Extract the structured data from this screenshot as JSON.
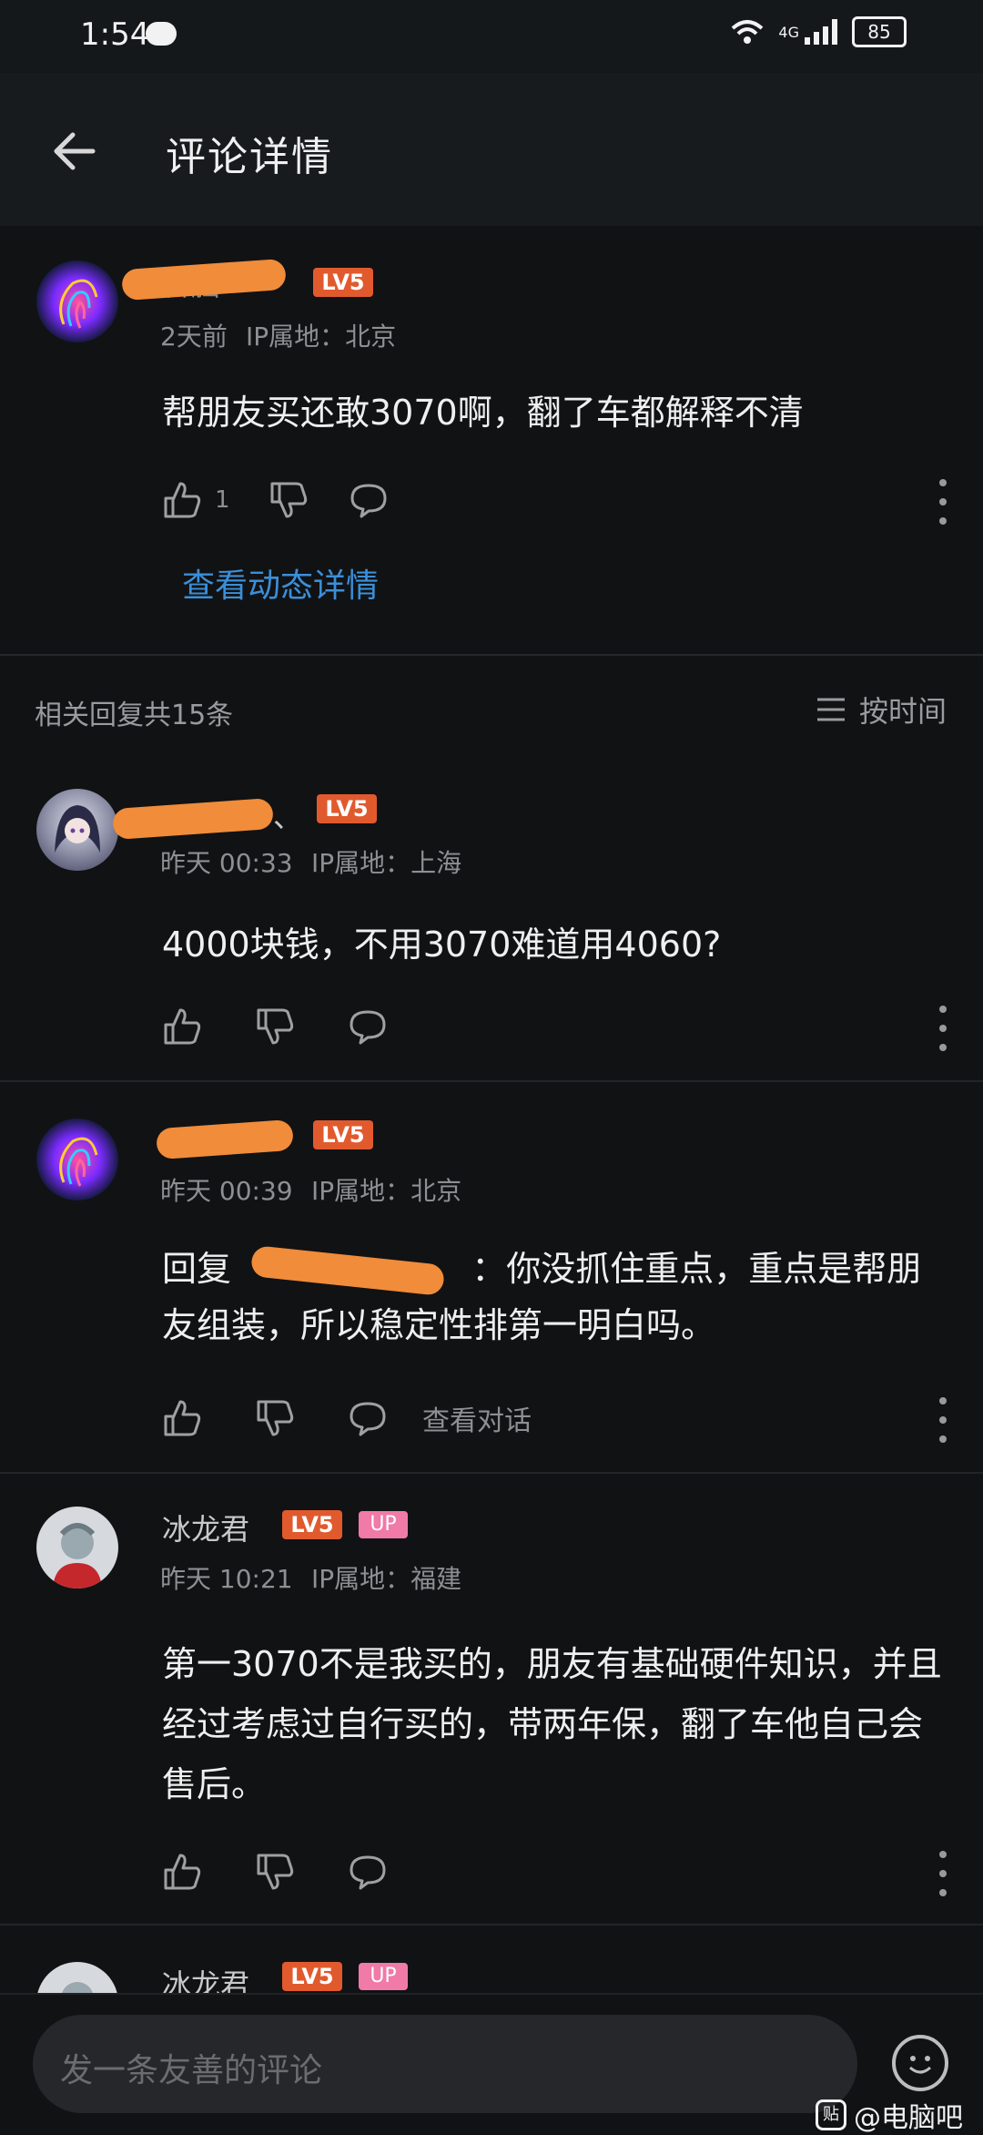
{
  "status_bar": {
    "time": "1:54",
    "network": "4G",
    "battery": "85"
  },
  "header": {
    "title": "评论详情"
  },
  "main_comment": {
    "author_visible": "智脑",
    "level": "LV5",
    "time": "2天前",
    "ip": "IP属地：北京",
    "text": "帮朋友买还敢3070啊，翻了车都解释不清",
    "likes": "1",
    "detail_link": "查看动态详情"
  },
  "replies_section": {
    "label": "相关回复共15条",
    "sort_label": "按时间"
  },
  "replies": [
    {
      "author_visible": "、",
      "level": "LV5",
      "time": "昨天 00:33",
      "ip": "IP属地：上海",
      "text": "4000块钱，不用3070难道用4060?"
    },
    {
      "author_visible": "",
      "level": "LV5",
      "time": "昨天 00:39",
      "ip": "IP属地：北京",
      "reply_prefix": "回复",
      "text": "：你没抓住重点，重点是帮朋友组装，所以稳定性排第一明白吗。",
      "view_conversation": "查看对话"
    },
    {
      "author": "冰龙君",
      "level": "LV5",
      "badge": "UP",
      "time": "昨天 10:21",
      "ip": "IP属地：福建",
      "text": "第一3070不是我买的，朋友有基础硬件知识，并且经过考虑过自行买的，带两年保，翻了车他自己会售后。"
    },
    {
      "author": "冰龙君",
      "level": "LV5",
      "badge": "UP"
    }
  ],
  "input": {
    "placeholder": "发一条友善的评论"
  },
  "watermark": {
    "text": "@电脑吧",
    "logo_text": "贴"
  },
  "colors": {
    "background": "#111214",
    "accent": "#3b8fd9",
    "level_badge": "#e15a2e",
    "redaction": "#f08c3a"
  },
  "icons": [
    "back-arrow-icon",
    "like-icon",
    "dislike-icon",
    "comment-icon",
    "more-icon",
    "sort-list-icon",
    "emoji-icon"
  ]
}
